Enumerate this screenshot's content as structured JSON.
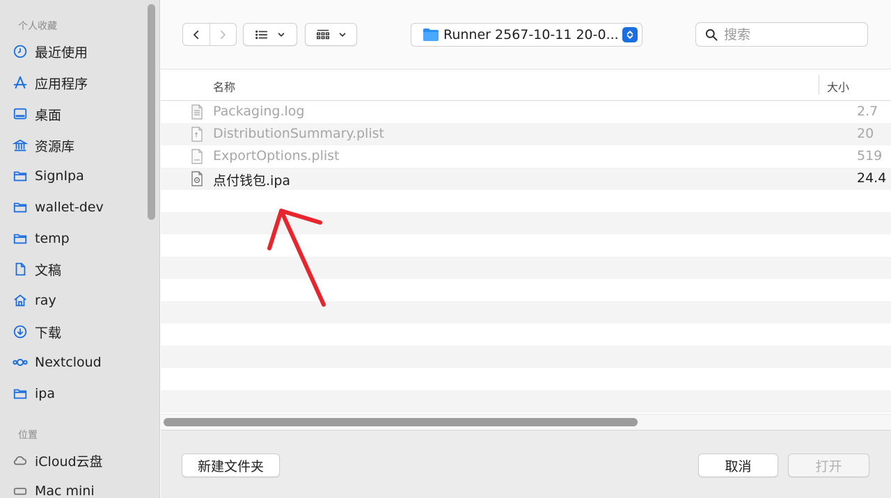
{
  "sidebar": {
    "favorites_title": "个人收藏",
    "favorites": [
      {
        "label": "最近使用",
        "icon": "clock-icon"
      },
      {
        "label": "应用程序",
        "icon": "apps-icon"
      },
      {
        "label": "桌面",
        "icon": "desktop-icon"
      },
      {
        "label": "资源库",
        "icon": "library-icon"
      },
      {
        "label": "SignIpa",
        "icon": "folder-icon"
      },
      {
        "label": "wallet-dev",
        "icon": "folder-icon"
      },
      {
        "label": "temp",
        "icon": "folder-icon"
      },
      {
        "label": "文稿",
        "icon": "document-icon"
      },
      {
        "label": "ray",
        "icon": "home-icon"
      },
      {
        "label": "下载",
        "icon": "download-icon"
      },
      {
        "label": "Nextcloud",
        "icon": "nextcloud-icon"
      },
      {
        "label": "ipa",
        "icon": "folder-icon"
      }
    ],
    "locations_title": "位置",
    "locations": [
      {
        "label": "iCloud云盘",
        "icon": "cloud-icon"
      },
      {
        "label": "Mac mini",
        "icon": "computer-icon"
      }
    ]
  },
  "toolbar": {
    "path": "Runner 2567-10-11 20-0...",
    "search_placeholder": "搜索"
  },
  "list": {
    "col_name": "名称",
    "col_size": "大小",
    "files": [
      {
        "name": "Packaging.log",
        "size": "2.7",
        "enabled": false
      },
      {
        "name": "DistributionSummary.plist",
        "size": "20",
        "enabled": false
      },
      {
        "name": "ExportOptions.plist",
        "size": "519",
        "enabled": false
      },
      {
        "name": "点付钱包.ipa",
        "size": "24.4",
        "enabled": true
      }
    ]
  },
  "footer": {
    "new_folder": "新建文件夹",
    "cancel": "取消",
    "open": "打开"
  },
  "colors": {
    "accent": "#1b6fe0",
    "annotation_arrow": "#e8242d"
  }
}
